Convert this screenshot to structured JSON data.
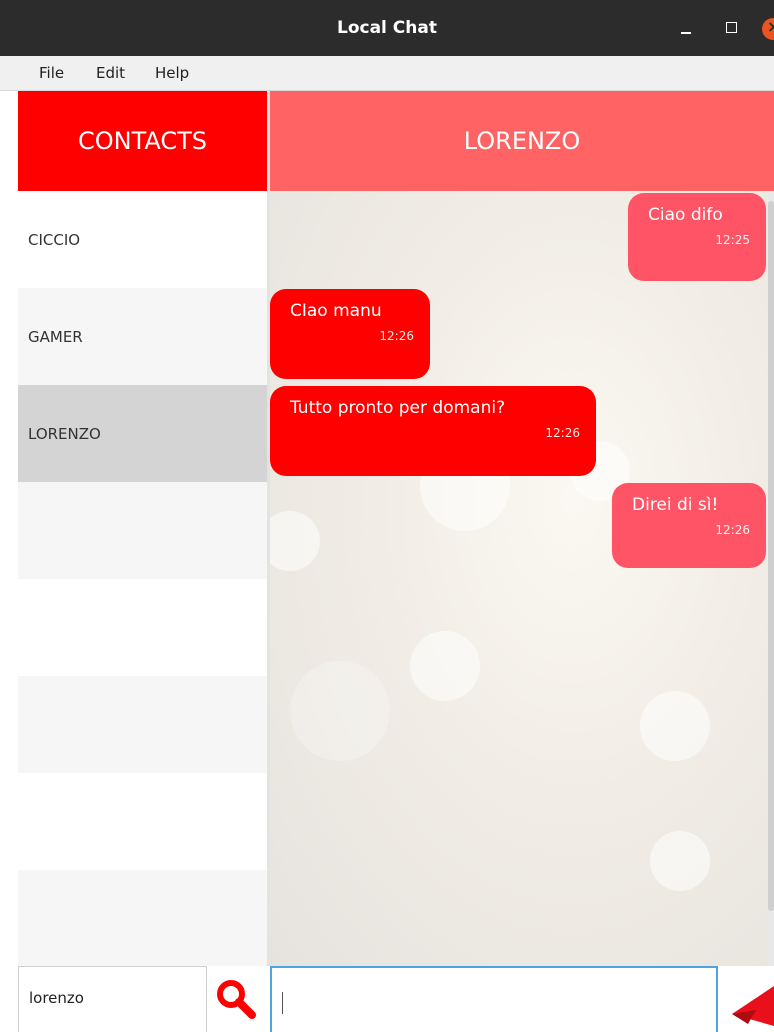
{
  "window": {
    "title": "Local Chat"
  },
  "menu": [
    "File",
    "Edit",
    "Help"
  ],
  "contacts_header": "CONTACTS",
  "contacts": [
    {
      "name": "CICCIO",
      "selected": false
    },
    {
      "name": "GAMER",
      "selected": false
    },
    {
      "name": "LORENZO",
      "selected": true
    }
  ],
  "chat": {
    "title": "LORENZO",
    "messages": [
      {
        "text": "Ciao difo",
        "time": "12:25",
        "from": "me"
      },
      {
        "text": "CIao manu",
        "time": "12:26",
        "from": "them"
      },
      {
        "text": "Tutto pronto per domani?",
        "time": "12:26",
        "from": "them"
      },
      {
        "text": "Direi di sì!",
        "time": "12:26",
        "from": "me"
      }
    ]
  },
  "search": {
    "value": "lorenzo"
  },
  "message_input": {
    "value": ""
  },
  "colors": {
    "contacts_header": "#ff0000",
    "chat_header": "#ff6363",
    "bubble_me": "#ff5465",
    "bubble_them": "#ff0000",
    "selected_contact": "#d4d4d4",
    "input_focus": "#4fa3e0"
  },
  "icons": {
    "search": "search-icon",
    "send": "paper-plane-icon"
  }
}
